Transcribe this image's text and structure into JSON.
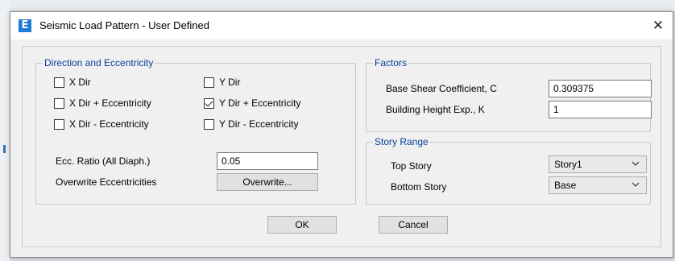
{
  "window": {
    "title": "Seismic Load Pattern - User Defined",
    "icon_letter": "E",
    "close_symbol": "✕"
  },
  "direction_group": {
    "legend": "Direction and Eccentricity",
    "x_dir": {
      "label": "X Dir",
      "checked": false
    },
    "x_dir_plus_ecc": {
      "label": "X Dir + Eccentricity",
      "checked": false
    },
    "x_dir_minus_ecc": {
      "label": "X Dir - Eccentricity",
      "checked": false
    },
    "y_dir": {
      "label": "Y Dir",
      "checked": false
    },
    "y_dir_plus_ecc": {
      "label": "Y Dir + Eccentricity",
      "checked": true
    },
    "y_dir_minus_ecc": {
      "label": "Y Dir - Eccentricity",
      "checked": false
    },
    "ecc_ratio_label": "Ecc. Ratio (All Diaph.)",
    "ecc_ratio_value": "0.05",
    "overwrite_label": "Overwrite Eccentricities",
    "overwrite_button": "Overwrite..."
  },
  "factors_group": {
    "legend": "Factors",
    "base_shear_label": "Base Shear Coefficient, C",
    "base_shear_value": "0.309375",
    "height_exp_label": "Building Height Exp., K",
    "height_exp_value": "1"
  },
  "story_range_group": {
    "legend": "Story Range",
    "top_story_label": "Top Story",
    "top_story_value": "Story1",
    "bottom_story_label": "Bottom Story",
    "bottom_story_value": "Base"
  },
  "buttons": {
    "ok": "OK",
    "cancel": "Cancel"
  },
  "colors": {
    "legend_text": "#0a3f99",
    "app_icon": "#1e7bd6"
  }
}
